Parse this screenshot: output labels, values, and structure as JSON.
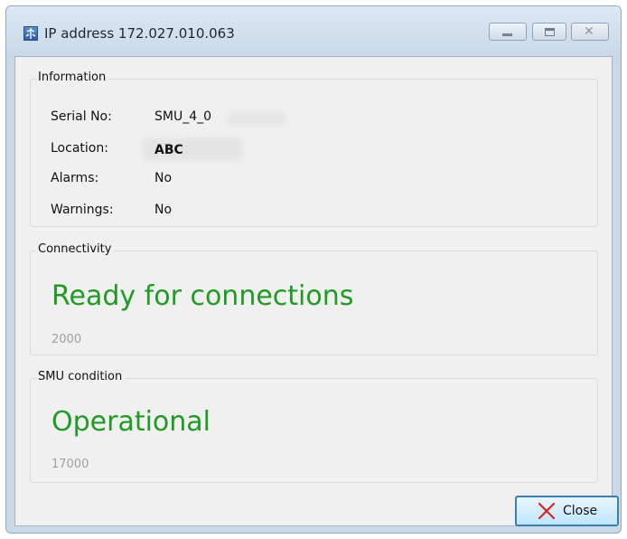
{
  "window": {
    "title": "IP address 172.027.010.063",
    "controls": {
      "minimize": "minimize-icon",
      "maximize": "maximize-icon",
      "close": "close-icon"
    }
  },
  "information": {
    "group_label": "Information",
    "rows": [
      {
        "label": "Serial No:",
        "value": "SMU_4_0"
      },
      {
        "label": "Location:",
        "value": "ABC"
      },
      {
        "label": "Alarms:",
        "value": "No"
      },
      {
        "label": "Warnings:",
        "value": "No"
      }
    ]
  },
  "connectivity": {
    "group_label": "Connectivity",
    "status": "Ready for connections",
    "code": "2000",
    "status_color": "#1f9a22"
  },
  "smu_condition": {
    "group_label": "SMU condition",
    "status": "Operational",
    "code": "17000",
    "status_color": "#1f9a22"
  },
  "footer": {
    "close_label": "Close",
    "close_icon": "red-x-icon"
  }
}
